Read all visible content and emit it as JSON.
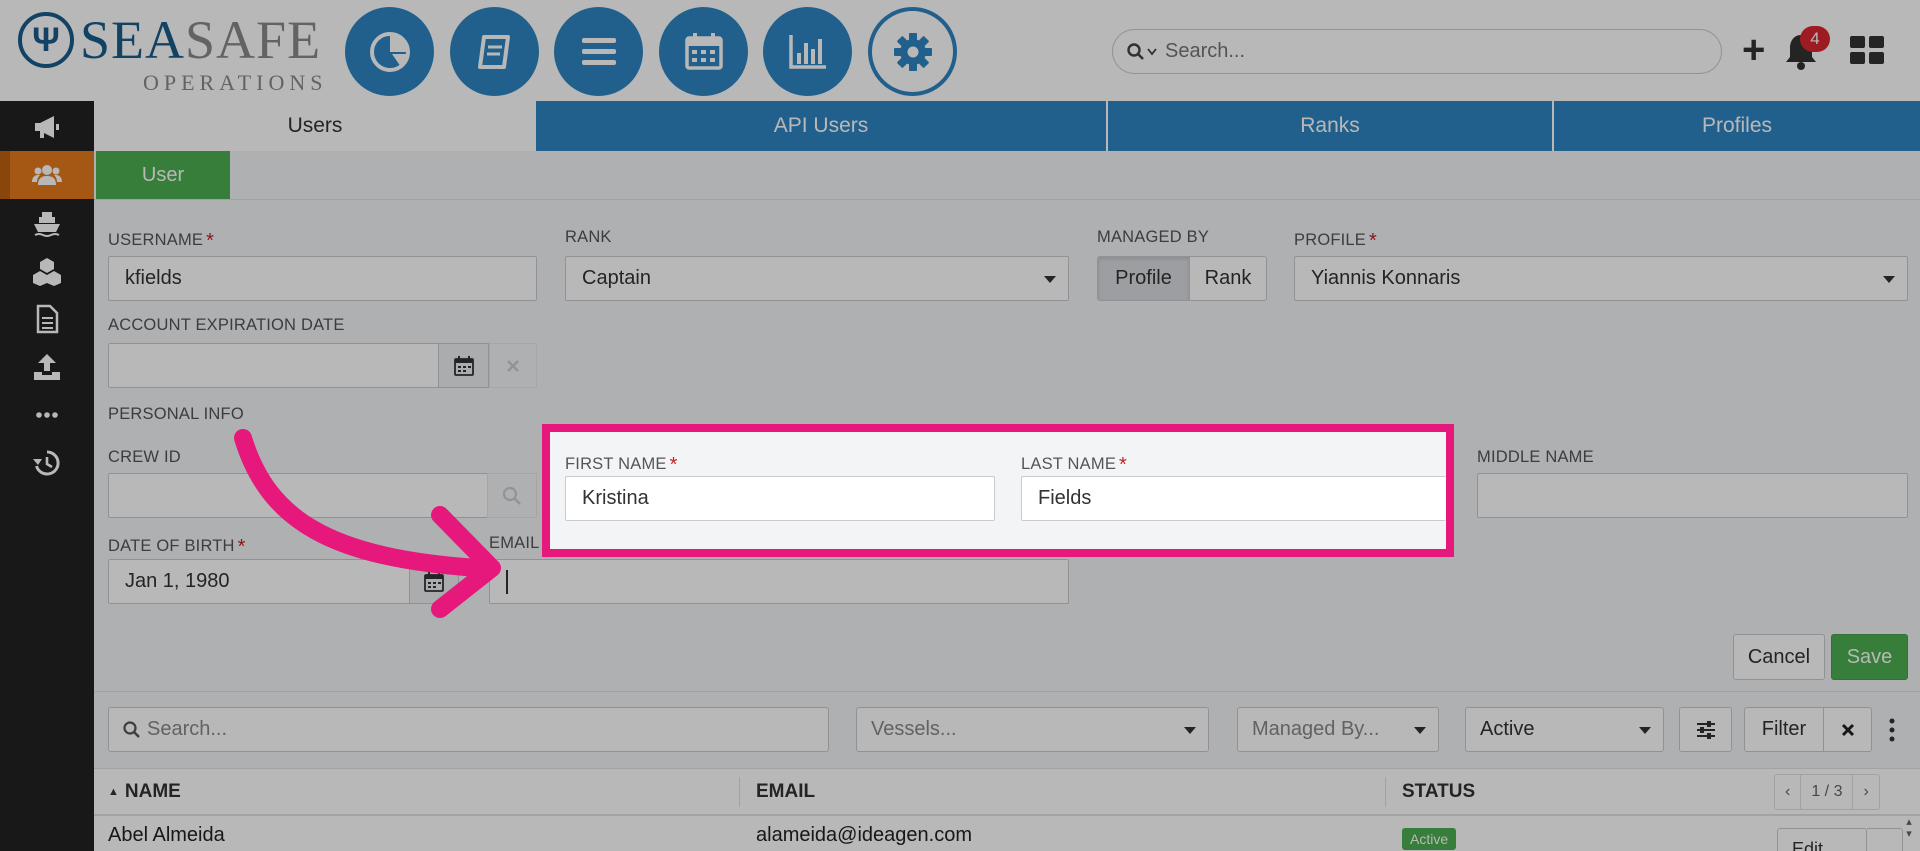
{
  "brand": {
    "name_part1": "SEA",
    "name_part2": "SAFE",
    "subtitle": "OPERATIONS"
  },
  "header": {
    "nav_icons": [
      "dashboard-pie-icon",
      "logbook-icon",
      "menu-list-icon",
      "calendar-icon",
      "reports-chart-icon",
      "settings-gear-icon"
    ],
    "search_placeholder": "Search...",
    "notification_count": "4"
  },
  "sidebar": {
    "items": [
      "megaphone-icon",
      "users-icon",
      "ship-icon",
      "cubes-icon",
      "document-icon",
      "upload-icon",
      "more-icon",
      "history-icon"
    ],
    "active": "users-icon"
  },
  "tabs": [
    "Users",
    "API Users",
    "Ranks",
    "Profiles"
  ],
  "subtab": "User",
  "form": {
    "username_label": "USERNAME",
    "username_value": "kfields",
    "rank_label": "RANK",
    "rank_value": "Captain",
    "managed_by_label": "MANAGED BY",
    "managed_by_options": [
      "Profile",
      "Rank"
    ],
    "managed_by_selected": "Profile",
    "profile_label": "PROFILE",
    "profile_value": "Yiannis Konnaris",
    "expiration_label": "ACCOUNT EXPIRATION DATE",
    "expiration_value": "",
    "personal_info_label": "PERSONAL INFO",
    "crew_id_label": "CREW ID",
    "crew_id_value": "",
    "first_name_label": "FIRST NAME",
    "first_name_value": "Kristina",
    "last_name_label": "LAST NAME",
    "last_name_value": "Fields",
    "middle_name_label": "MIDDLE NAME",
    "middle_name_value": "",
    "dob_label": "DATE OF BIRTH",
    "dob_value": "Jan 1, 1980",
    "email_label": "EMAIL",
    "email_value": "",
    "cancel_label": "Cancel",
    "save_label": "Save"
  },
  "filters": {
    "search_placeholder": "Search...",
    "vessels_placeholder": "Vessels...",
    "managed_by_placeholder": "Managed By...",
    "status_value": "Active",
    "filter_label": "Filter"
  },
  "table": {
    "columns": [
      "NAME",
      "EMAIL",
      "STATUS"
    ],
    "pager": "1 / 3",
    "rows": [
      {
        "name": "Abel Almeida",
        "email": "alameida@ideagen.com",
        "status": "Active",
        "action": "Edit"
      }
    ]
  },
  "colors": {
    "accent": "#2f86c2",
    "success": "#4caf50",
    "highlight": "#e6187c",
    "sidebar_active": "#e37b1c"
  }
}
